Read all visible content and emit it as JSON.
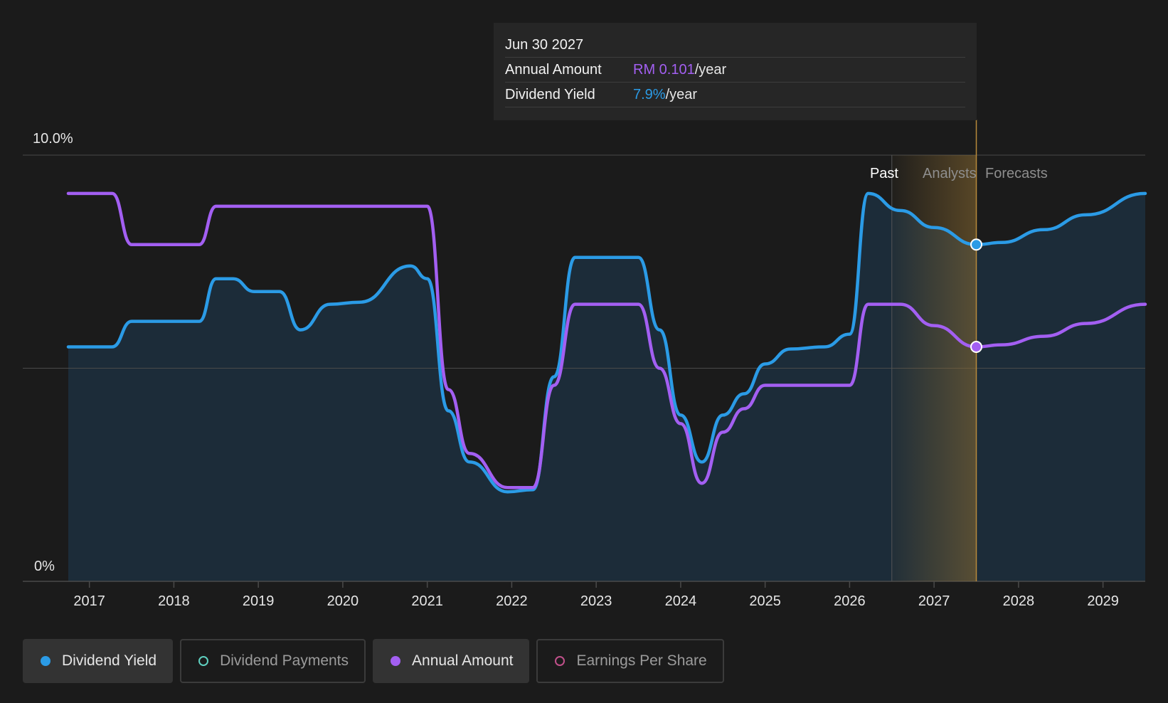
{
  "tooltip": {
    "date": "Jun 30 2027",
    "rows": [
      {
        "label": "Annual Amount",
        "value": "RM 0.101",
        "unit": "/year"
      },
      {
        "label": "Dividend Yield",
        "value": "7.9%",
        "unit": "/year"
      }
    ]
  },
  "period_labels": {
    "past": "Past",
    "forecast_a": "Analysts",
    "forecast_b": "Forecasts"
  },
  "legend": [
    {
      "label": "Dividend Yield",
      "active": true,
      "color": "#2b9be6"
    },
    {
      "label": "Dividend Payments",
      "active": false,
      "color": "#5fd0c0"
    },
    {
      "label": "Annual Amount",
      "active": true,
      "color": "#a35ff2"
    },
    {
      "label": "Earnings Per Share",
      "active": false,
      "color": "#c0508a"
    }
  ],
  "chart_data": {
    "type": "line",
    "title": "",
    "xlabel": "",
    "ylabel": "",
    "ylim": [
      0,
      10
    ],
    "y_tick_labels": [
      "0%",
      "10.0%"
    ],
    "x_tick_labels": [
      "2017",
      "2018",
      "2019",
      "2020",
      "2021",
      "2022",
      "2023",
      "2024",
      "2025",
      "2026",
      "2027",
      "2028",
      "2029"
    ],
    "xlim": [
      2016.75,
      2029.5
    ],
    "past_end": 2026.5,
    "highlight_x": 2027.5,
    "grid": true,
    "colors": {
      "yield": "#2b9be6",
      "amount": "#a35ff2",
      "highlight": "#b8893a"
    },
    "series": [
      {
        "name": "Dividend Yield",
        "color": "#2b9be6",
        "points": [
          [
            2016.75,
            5.5
          ],
          [
            2017.27,
            5.5
          ],
          [
            2017.5,
            6.1
          ],
          [
            2018.3,
            6.1
          ],
          [
            2018.5,
            7.1
          ],
          [
            2018.7,
            7.1
          ],
          [
            2018.95,
            6.8
          ],
          [
            2019.25,
            6.8
          ],
          [
            2019.5,
            5.9
          ],
          [
            2019.85,
            6.5
          ],
          [
            2020.2,
            6.55
          ],
          [
            2020.8,
            7.4
          ],
          [
            2021.0,
            7.1
          ],
          [
            2021.25,
            4.0
          ],
          [
            2021.5,
            2.8
          ],
          [
            2021.95,
            2.1
          ],
          [
            2022.25,
            2.15
          ],
          [
            2022.5,
            4.8
          ],
          [
            2022.75,
            7.6
          ],
          [
            2023.5,
            7.6
          ],
          [
            2023.75,
            5.9
          ],
          [
            2024.0,
            3.9
          ],
          [
            2024.25,
            2.8
          ],
          [
            2024.5,
            3.9
          ],
          [
            2024.75,
            4.4
          ],
          [
            2025.0,
            5.1
          ],
          [
            2025.3,
            5.45
          ],
          [
            2025.7,
            5.5
          ],
          [
            2026.0,
            5.8
          ],
          [
            2026.22,
            9.1
          ],
          [
            2026.6,
            8.7
          ],
          [
            2027.0,
            8.3
          ],
          [
            2027.5,
            7.9
          ],
          [
            2027.8,
            7.95
          ],
          [
            2028.3,
            8.25
          ],
          [
            2028.8,
            8.6
          ],
          [
            2029.5,
            9.1
          ]
        ]
      },
      {
        "name": "Annual Amount",
        "color": "#a35ff2",
        "points": [
          [
            2016.75,
            9.1
          ],
          [
            2017.27,
            9.1
          ],
          [
            2017.5,
            7.9
          ],
          [
            2018.3,
            7.9
          ],
          [
            2018.5,
            8.8
          ],
          [
            2021.0,
            8.8
          ],
          [
            2021.25,
            4.5
          ],
          [
            2021.5,
            3.0
          ],
          [
            2021.95,
            2.2
          ],
          [
            2022.25,
            2.2
          ],
          [
            2022.5,
            4.6
          ],
          [
            2022.75,
            6.5
          ],
          [
            2023.5,
            6.5
          ],
          [
            2023.75,
            5.0
          ],
          [
            2024.0,
            3.7
          ],
          [
            2024.25,
            2.3
          ],
          [
            2024.5,
            3.5
          ],
          [
            2024.75,
            4.05
          ],
          [
            2025.0,
            4.6
          ],
          [
            2026.0,
            4.6
          ],
          [
            2026.22,
            6.5
          ],
          [
            2026.6,
            6.5
          ],
          [
            2027.0,
            6.0
          ],
          [
            2027.5,
            5.5
          ],
          [
            2027.8,
            5.55
          ],
          [
            2028.3,
            5.75
          ],
          [
            2028.8,
            6.05
          ],
          [
            2029.5,
            6.5
          ]
        ]
      }
    ]
  }
}
